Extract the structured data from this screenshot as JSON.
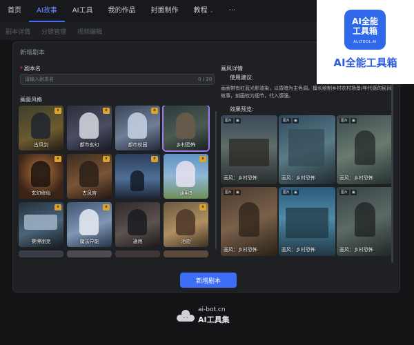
{
  "topnav": {
    "items": [
      {
        "label": "首页"
      },
      {
        "label": "AI故事",
        "active": true
      },
      {
        "label": "AI工具"
      },
      {
        "label": "我的作品"
      },
      {
        "label": "封面制作"
      },
      {
        "label": "教程"
      },
      {
        "label": "···"
      }
    ]
  },
  "subnav": {
    "items": [
      "剧本详情",
      "分镜管理",
      "视频编辑"
    ]
  },
  "modal": {
    "title": "新增剧本",
    "script_name": {
      "label": "剧本名",
      "placeholder": "请输入剧本名",
      "value": "",
      "counter": "0 / 20"
    },
    "style_section_label": "画面风格",
    "styles": [
      {
        "name": "古风剑",
        "vip": true
      },
      {
        "name": "都市玄幻",
        "vip": true
      },
      {
        "name": "都市校园",
        "vip": true
      },
      {
        "name": "乡村恐怖",
        "vip": false,
        "selected": true
      },
      {
        "name": "玄幻修仙",
        "vip": true
      },
      {
        "name": "古风宫",
        "vip": true
      },
      {
        "name": "",
        "vip": true
      },
      {
        "name": "通用B",
        "vip": true
      },
      {
        "name": "赛博朋克",
        "vip": true
      },
      {
        "name": "魔法异能",
        "vip": true
      },
      {
        "name": "通用",
        "vip": false
      },
      {
        "name": "治愈",
        "vip": true
      }
    ],
    "detail": {
      "title": "画风详情",
      "usage_label": "使用建议:",
      "description": "画面带有红蓝光影渲染，以昏暗为主色调，擅长绘制乡村农村场景/年代感的民间故事，刻画较为细节，代入感强。",
      "preview_label": "效果预览:",
      "previews": [
        {
          "caption": "画风：乡村恐怖",
          "tag1": "图片",
          "tag2": "▣"
        },
        {
          "caption": "画风：乡村恐怖",
          "tag1": "图片",
          "tag2": "▣"
        },
        {
          "caption": "画风：乡村恐怖",
          "tag1": "图片",
          "tag2": "▣"
        },
        {
          "caption": "画风：乡村恐怖",
          "tag1": "图片",
          "tag2": "▣"
        },
        {
          "caption": "画风：乡村恐怖",
          "tag1": "图片",
          "tag2": "▣"
        },
        {
          "caption": "画风：乡村恐怖",
          "tag1": "图片",
          "tag2": "▣"
        }
      ]
    },
    "submit_label": "新增剧本"
  },
  "brand_badge": {
    "logo_line1": "AI全能",
    "logo_line2": "工具箱",
    "logo_line3": "ALLTOOL.AI",
    "name": "AI全能工具箱"
  },
  "watermark": {
    "url": "ai-bot.cn",
    "name": "AI工具集"
  },
  "colors": {
    "accent": "#3b6df5",
    "selected_outline": "#9c7cf2",
    "vip_badge": "#d9a530",
    "brand_blue": "#2f68e8"
  }
}
